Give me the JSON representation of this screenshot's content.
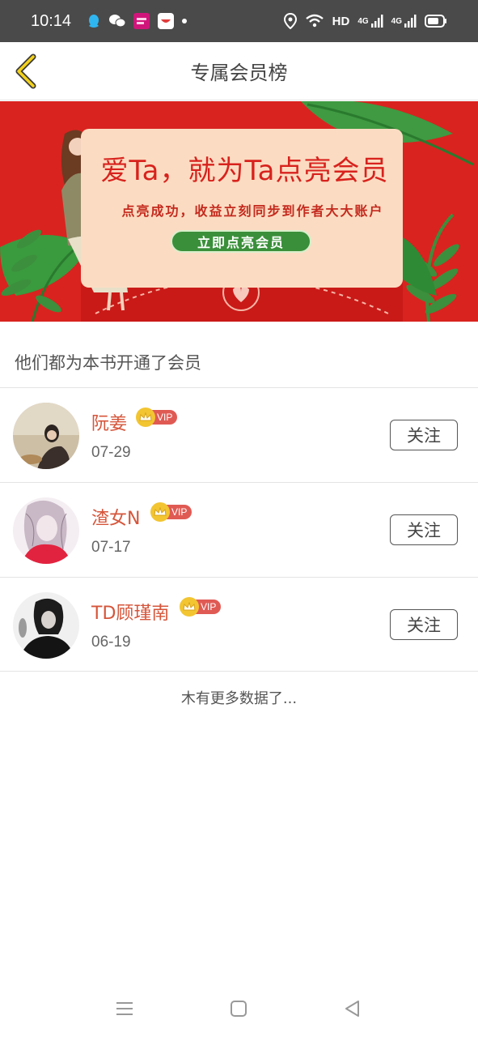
{
  "status_bar": {
    "time": "10:14",
    "network_label": "HD",
    "signal_label_1": "4G",
    "signal_label_2": "4G"
  },
  "nav": {
    "title": "专属会员榜",
    "back_icon": "chevron-left-icon"
  },
  "banner": {
    "title": "爱Ta，就为Ta点亮会员",
    "subtitle": "点亮成功，收益立刻同步到作者大大账户",
    "button_label": "立即点亮会员"
  },
  "section": {
    "title": "他们都为本书开通了会员"
  },
  "members": [
    {
      "name": "阮姜",
      "date": "07-29",
      "badge": "VIP",
      "follow_label": "关注"
    },
    {
      "name": "渣女N",
      "date": "07-17",
      "badge": "VIP",
      "follow_label": "关注"
    },
    {
      "name": "TD顾瑾南",
      "date": "06-19",
      "badge": "VIP",
      "follow_label": "关注"
    }
  ],
  "footer": {
    "no_more": "木有更多数据了..."
  },
  "colors": {
    "accent_name": "#d6553a",
    "banner_red": "#d9231f",
    "vip_red": "#e05a54",
    "crown_gold": "#f2c531"
  }
}
